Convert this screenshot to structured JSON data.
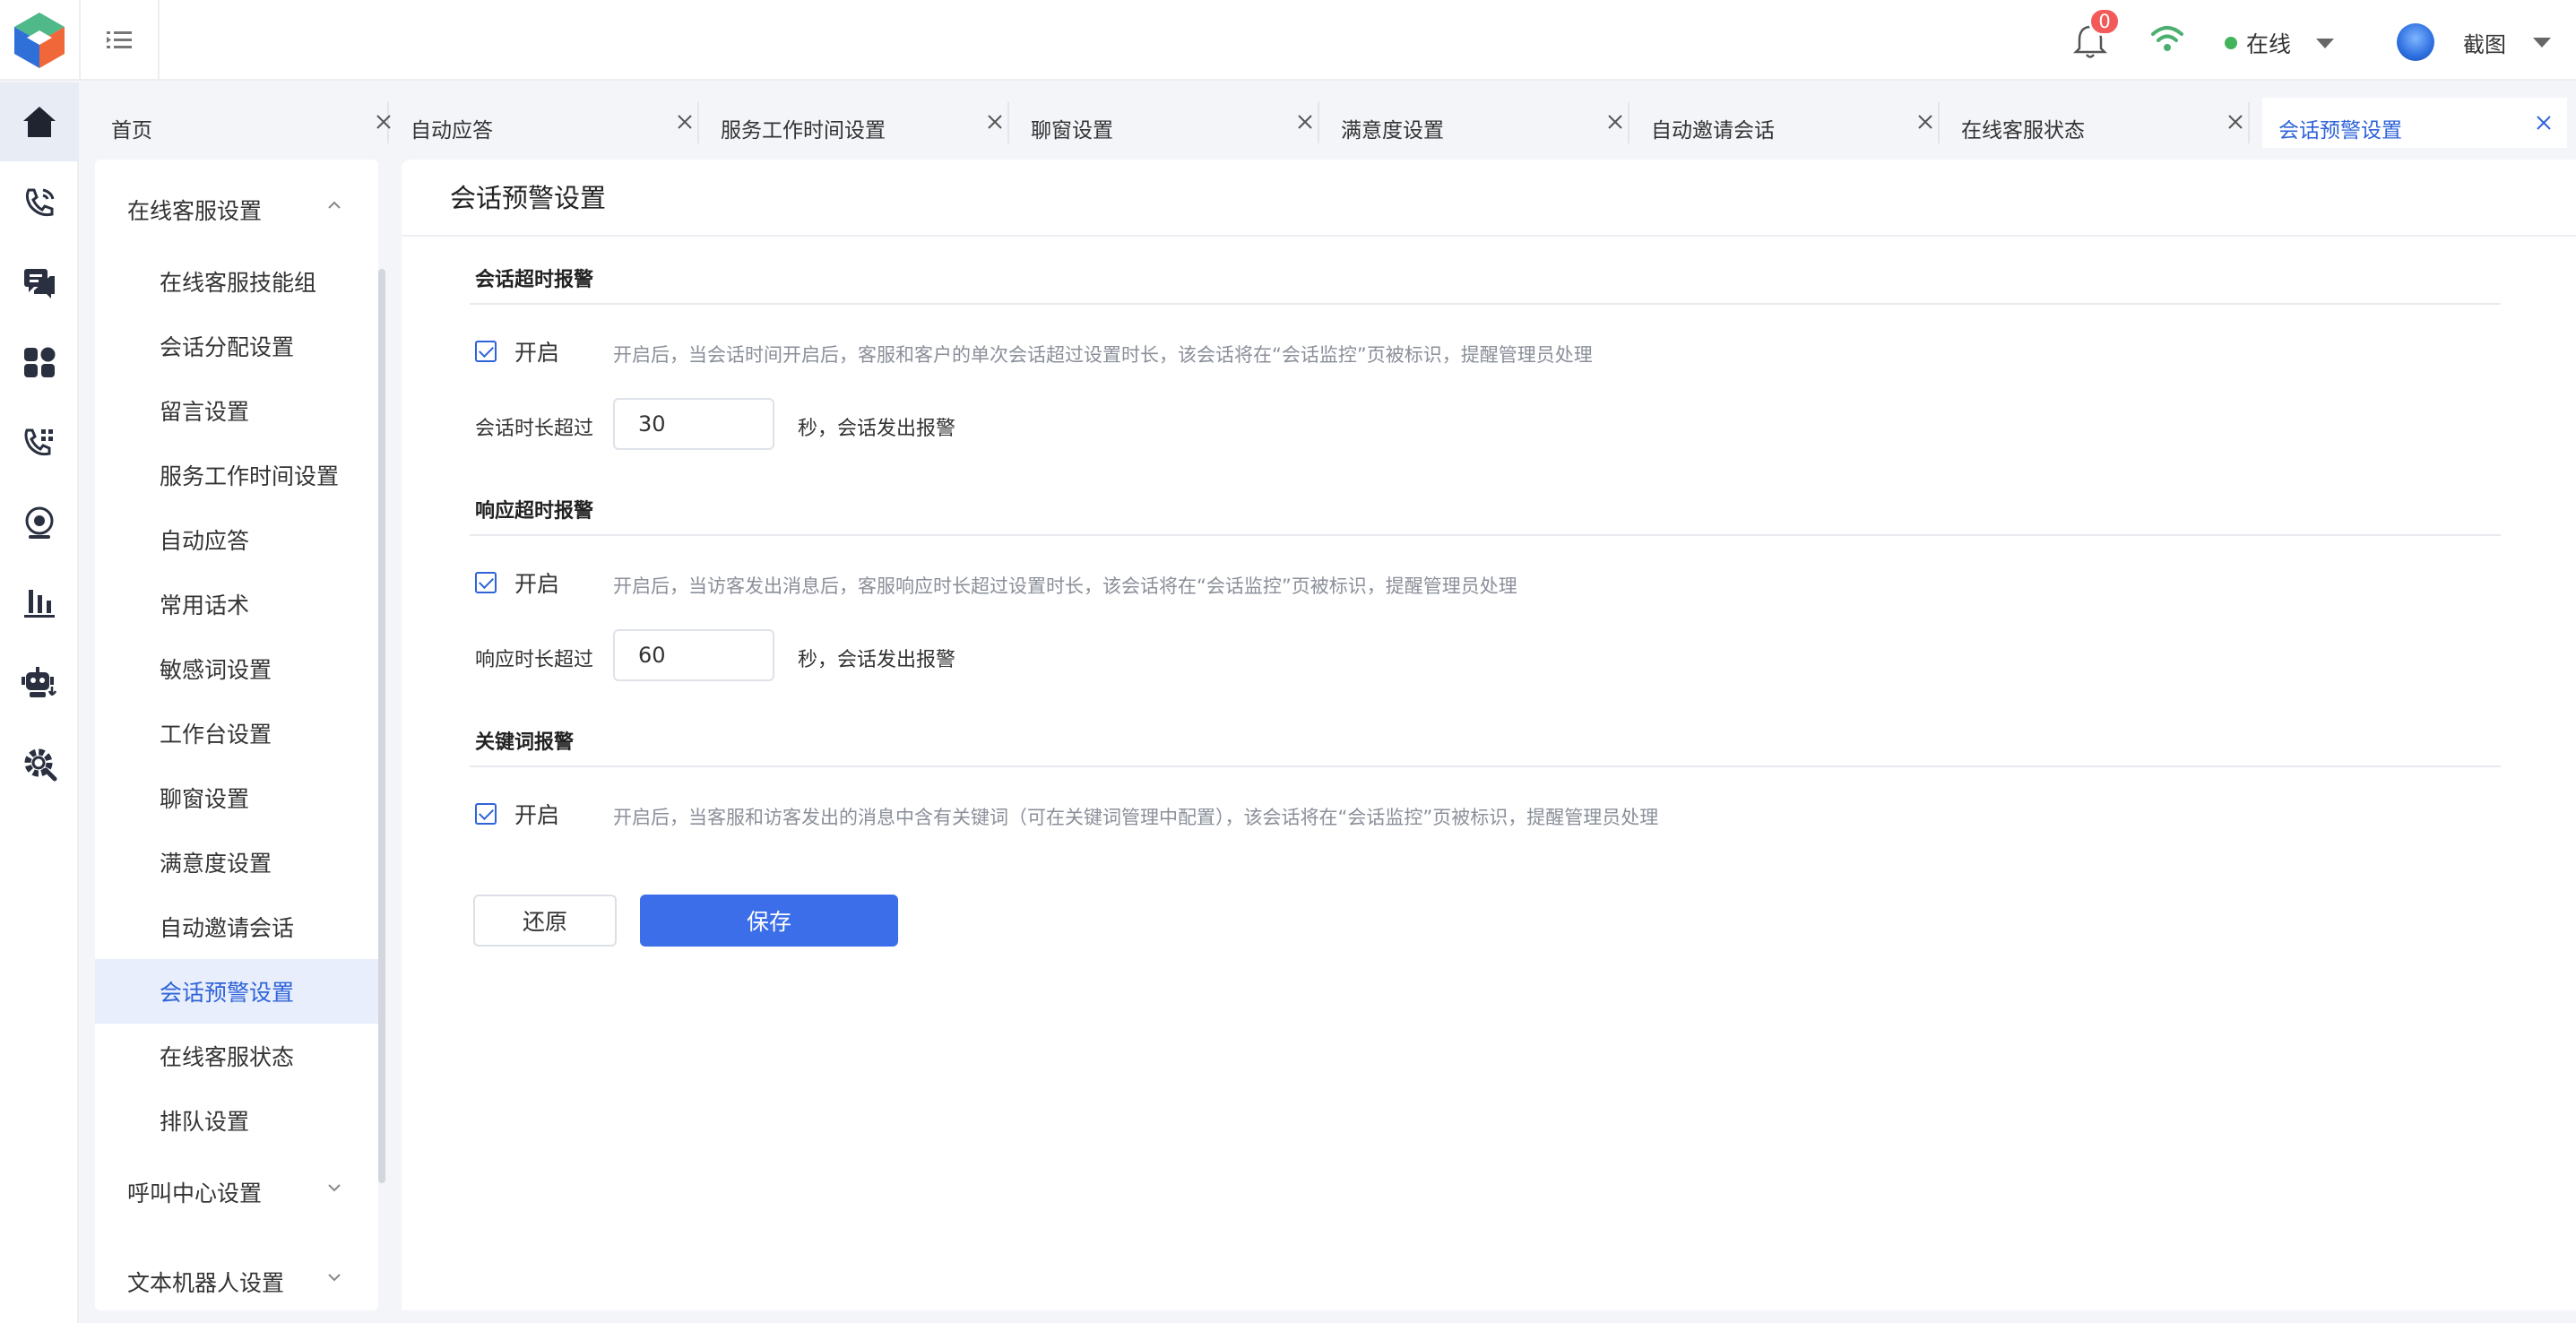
{
  "header": {
    "notification_count": "0",
    "status_label": "在线",
    "status_color": "#43b35c",
    "user_name": "截图"
  },
  "rail": {
    "items": [
      "home-icon",
      "phone-icon",
      "chat-icon",
      "apps-icon",
      "call-transfer-icon",
      "monitor-icon",
      "chart-icon",
      "robot-icon",
      "settings-icon"
    ]
  },
  "tabs": [
    {
      "label": "首页"
    },
    {
      "label": "自动应答"
    },
    {
      "label": "服务工作时间设置"
    },
    {
      "label": "聊窗设置"
    },
    {
      "label": "满意度设置"
    },
    {
      "label": "自动邀请会话"
    },
    {
      "label": "在线客服状态"
    },
    {
      "label": "会话预警设置"
    }
  ],
  "subnav": {
    "groups": [
      {
        "label": "在线客服设置"
      },
      {
        "label": "呼叫中心设置"
      },
      {
        "label": "文本机器人设置"
      }
    ],
    "items": [
      {
        "label": "在线客服技能组"
      },
      {
        "label": "会话分配设置"
      },
      {
        "label": "留言设置"
      },
      {
        "label": "服务工作时间设置"
      },
      {
        "label": "自动应答"
      },
      {
        "label": "常用话术"
      },
      {
        "label": "敏感词设置"
      },
      {
        "label": "工作台设置"
      },
      {
        "label": "聊窗设置"
      },
      {
        "label": "满意度设置"
      },
      {
        "label": "自动邀请会话"
      },
      {
        "label": "会话预警设置"
      },
      {
        "label": "在线客服状态"
      },
      {
        "label": "排队设置"
      }
    ]
  },
  "main": {
    "title": "会话预警设置",
    "sections": [
      {
        "title": "会话超时报警",
        "checkbox_label": "开启",
        "hint": "开启后，当会话时间开启后，客服和客户的单次会话超过设置时长，该会话将在“会话监控”页被标识，提醒管理员处理",
        "field_label": "会话时长超过",
        "field_value": "30",
        "suffix": "秒，会话发出报警"
      },
      {
        "title": "响应超时报警",
        "checkbox_label": "开启",
        "hint": "开启后，当访客发出消息后，客服响应时长超过设置时长，该会话将在“会话监控”页被标识，提醒管理员处理",
        "field_label": "响应时长超过",
        "field_value": "60",
        "suffix": "秒，会话发出报警"
      },
      {
        "title": "关键词报警",
        "checkbox_label": "开启",
        "hint": "开启后，当客服和访客发出的消息中含有关键词（可在关键词管理中配置），该会话将在“会话监控”页被标识，提醒管理员处理"
      }
    ],
    "reset_label": "还原",
    "save_label": "保存",
    "accent_color": "#3b6ee8"
  }
}
